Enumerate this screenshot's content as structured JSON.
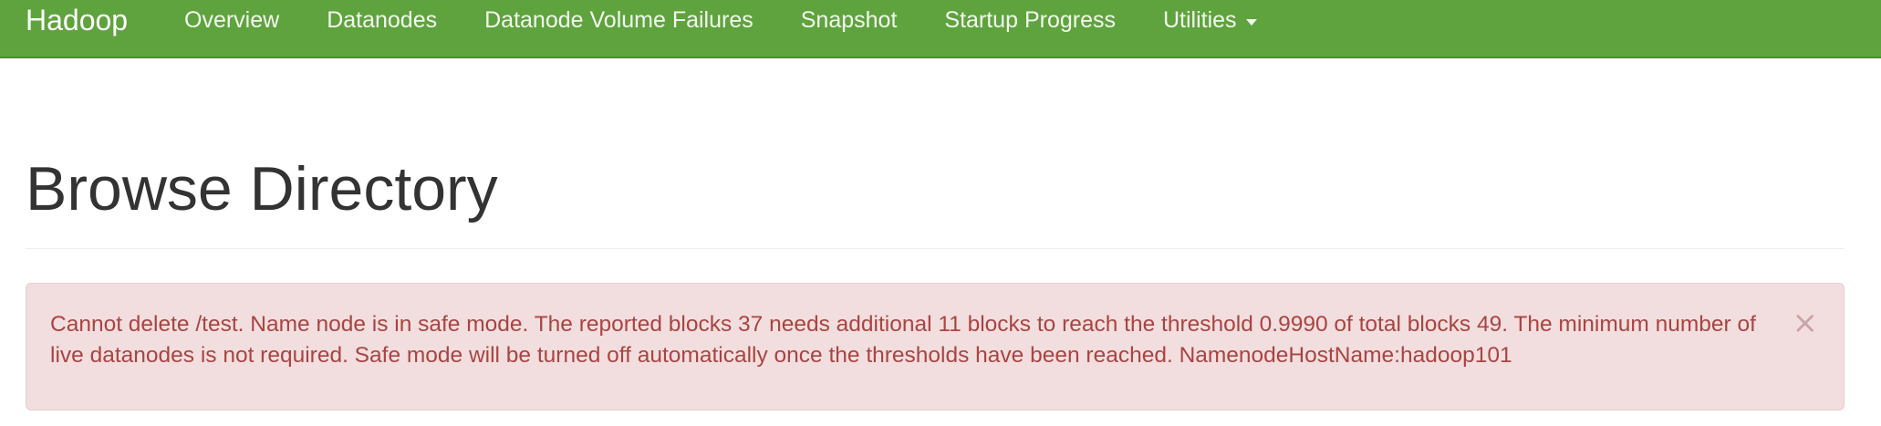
{
  "navbar": {
    "brand": "Hadoop",
    "items": [
      {
        "label": "Overview"
      },
      {
        "label": "Datanodes"
      },
      {
        "label": "Datanode Volume Failures"
      },
      {
        "label": "Snapshot"
      },
      {
        "label": "Startup Progress"
      },
      {
        "label": "Utilities"
      }
    ],
    "colors": {
      "background": "#5fa33e",
      "text": "#ffffff"
    }
  },
  "page": {
    "title": "Browse Directory"
  },
  "alert": {
    "message": "Cannot delete /test. Name node is in safe mode. The reported blocks 37 needs additional 11 blocks to reach the threshold 0.9990 of total blocks 49. The minimum number of live datanodes is not required. Safe mode will be turned off automatically once the thresholds have been reached. NamenodeHostName:hadoop101",
    "close_glyph": "×",
    "colors": {
      "background": "#f2dede",
      "text": "#a94442",
      "border": "#ebccd1"
    }
  }
}
